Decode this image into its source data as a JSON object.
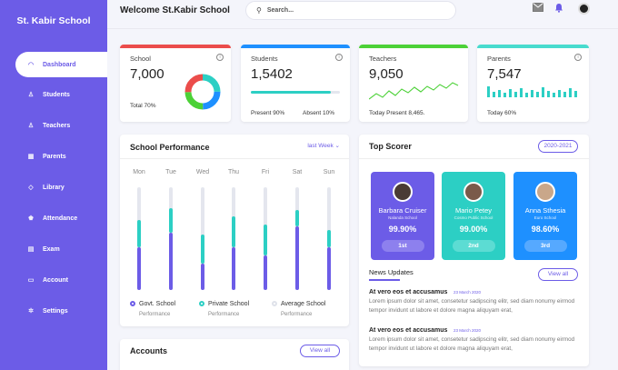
{
  "sidebar": {
    "brand": "St. Kabir School",
    "items": [
      {
        "label": "Dashboard",
        "icon": "◠"
      },
      {
        "label": "Students",
        "icon": "♙"
      },
      {
        "label": "Teachers",
        "icon": "♙"
      },
      {
        "label": "Parents",
        "icon": "▦"
      },
      {
        "label": "Library",
        "icon": "◇"
      },
      {
        "label": "Attendance",
        "icon": "♚"
      },
      {
        "label": "Exam",
        "icon": "▤"
      },
      {
        "label": "Account",
        "icon": "▭"
      },
      {
        "label": "Settings",
        "icon": "✲"
      }
    ]
  },
  "header": {
    "welcome": "Welcome St.Kabir School",
    "search_placeholder": "Search...",
    "icons": [
      "mail-icon",
      "bell-icon",
      "avatar"
    ]
  },
  "stats": {
    "school": {
      "title": "School",
      "value": "7,000",
      "foot": "Total  70%",
      "color": "#eb4d4b"
    },
    "students": {
      "title": "Students",
      "value": "1,5402",
      "foot_left": "Present  90%",
      "foot_right": "Absent  10%",
      "color": "#1e90ff",
      "progress": 0.9
    },
    "teachers": {
      "title": "Teachers",
      "value": "9,050",
      "foot": "Today Present 8,465.",
      "color": "#4cd137"
    },
    "parents": {
      "title": "Parents",
      "value": "7,547",
      "foot": "Today 60%",
      "color": "#48dbce"
    }
  },
  "performance": {
    "title": "School Performance",
    "filter": "last Week",
    "days": [
      "Mon",
      "Tue",
      "Wed",
      "Thu",
      "Fri",
      "Sat",
      "Sun"
    ],
    "govt": [
      0.42,
      0.56,
      0.26,
      0.42,
      0.34,
      0.62,
      0.42
    ],
    "private": [
      0.26,
      0.24,
      0.28,
      0.3,
      0.3,
      0.16,
      0.16
    ],
    "legend": [
      {
        "label": "Govt. School",
        "sub": "Performance",
        "color": "#6c5ce7"
      },
      {
        "label": "Private School",
        "sub": "Performance",
        "color": "#2ccfc4"
      },
      {
        "label": "Average School",
        "sub": "Performance",
        "color": "#dfe2ea"
      }
    ]
  },
  "accounts": {
    "title": "Accounts",
    "view_all": "View all"
  },
  "top_scorer": {
    "title": "Top Scorer",
    "year": "2020-2021",
    "students": [
      {
        "name": "Barbara Cruiser",
        "school": "Nalanda School",
        "score": "99.90%",
        "rank": "1st",
        "color": "#6c5ce7"
      },
      {
        "name": "Mario Petey",
        "school": "Cosmo Public School",
        "score": "99.00%",
        "rank": "2nd",
        "color": "#2ccfc4"
      },
      {
        "name": "Anna Sthesia",
        "school": "Euro School",
        "score": "98.60%",
        "rank": "3rd",
        "color": "#1e90ff"
      }
    ]
  },
  "news": {
    "title": "News Updates",
    "view_all": "View all",
    "items": [
      {
        "headline": "At vero eos et accusamus",
        "date": "23 March 2020",
        "body": "Lorem ipsum dolor sit amet, consetetur sadipscing elitr, sed diam nonumy eirmod tempor invidunt ut labore et dolore magna aliquyam erat,"
      },
      {
        "headline": "At vero eos et accusamus",
        "date": "23 March 2020",
        "body": "Lorem ipsum dolor sit amet, consetetur sadipscing elitr, sed diam nonumy eirmod tempor invidunt ut labore et dolore magna aliquyam erat,"
      }
    ]
  }
}
